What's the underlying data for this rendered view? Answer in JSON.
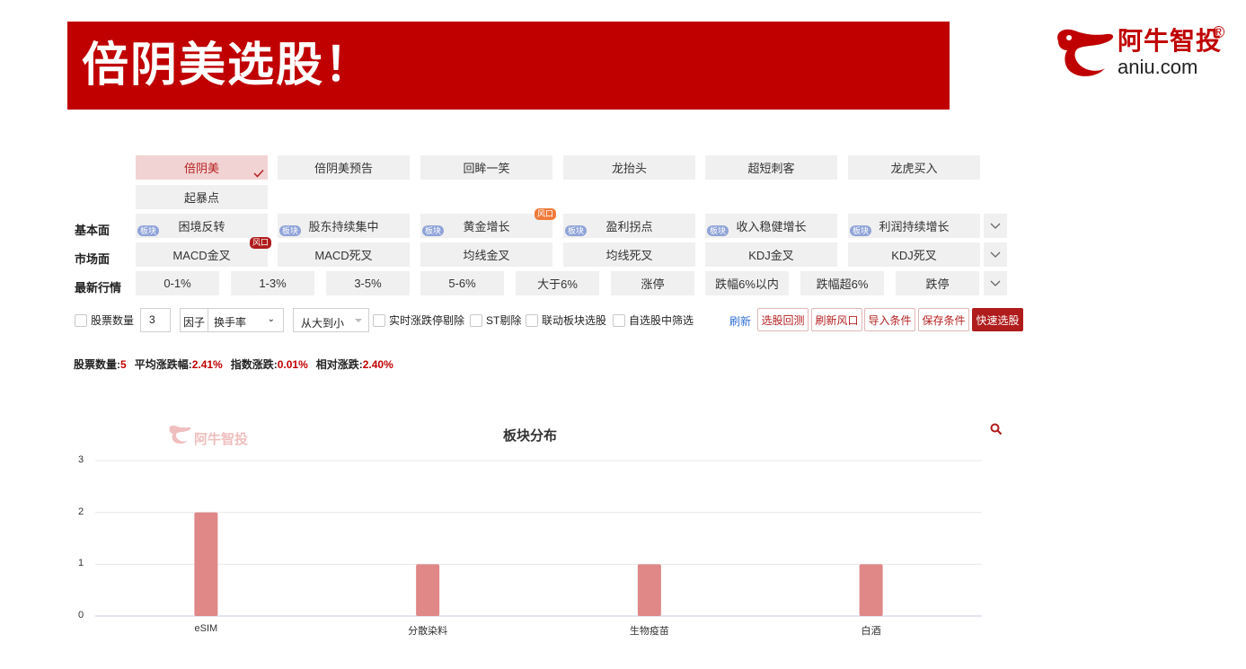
{
  "banner": {
    "title": "倍阴美选股！"
  },
  "logo": {
    "cn": "阿牛智投",
    "reg": "®",
    "en": "aniu.com"
  },
  "strategies": [
    {
      "label": "倍阴美",
      "active": true
    },
    {
      "label": "倍阴美预告"
    },
    {
      "label": "回眸一笑"
    },
    {
      "label": "龙抬头"
    },
    {
      "label": "超短刺客"
    },
    {
      "label": "龙虎买入"
    },
    {
      "label": "起暴点"
    }
  ],
  "rows": {
    "fundamental": {
      "label": "基本面",
      "items": [
        {
          "label": "困境反转",
          "badge": "板块"
        },
        {
          "label": "股东持续集中",
          "badge": "板块"
        },
        {
          "label": "黄金增长",
          "badge": "板块",
          "risk": "风口"
        },
        {
          "label": "盈利拐点",
          "badge": "板块"
        },
        {
          "label": "收入稳健增长",
          "badge": "板块"
        },
        {
          "label": "利润持续增长",
          "badge": "板块"
        }
      ]
    },
    "market": {
      "label": "市场面",
      "items": [
        {
          "label": "MACD金叉",
          "risk": "风口"
        },
        {
          "label": "MACD死叉"
        },
        {
          "label": "均线金叉"
        },
        {
          "label": "均线死叉"
        },
        {
          "label": "KDJ金叉"
        },
        {
          "label": "KDJ死叉"
        }
      ]
    },
    "quote": {
      "label": "最新行情",
      "items": [
        {
          "label": "0-1%"
        },
        {
          "label": "1-3%"
        },
        {
          "label": "3-5%"
        },
        {
          "label": "5-6%"
        },
        {
          "label": "大于6%"
        },
        {
          "label": "涨停"
        },
        {
          "label": "跌幅6%以内"
        },
        {
          "label": "跌幅超6%"
        },
        {
          "label": "跌停"
        }
      ]
    }
  },
  "controls": {
    "stock_count_label": "股票数量",
    "stock_count_value": "3",
    "factor_label": "因子",
    "factor_value": "换手率",
    "order_value": "从大到小",
    "realtime_limit_label": "实时涨跌停剔除",
    "st_label": "ST剔除",
    "linkage_label": "联动板块选股",
    "watchlist_label": "自选股中筛选",
    "refresh": "刷新",
    "backtest": "选股回测",
    "refresh_risk": "刷新风口",
    "import": "导入条件",
    "save": "保存条件",
    "quick": "快速选股"
  },
  "stats": [
    {
      "label": "股票数量:",
      "value": "5"
    },
    {
      "label": "平均涨跌幅:",
      "value": "2.41%"
    },
    {
      "label": "指数涨跌:",
      "value": "0.01%"
    },
    {
      "label": "相对涨跌:",
      "value": "2.40%"
    }
  ],
  "chart_data": {
    "type": "bar",
    "title": "板块分布",
    "categories": [
      "eSIM",
      "分散染料",
      "生物疫苗",
      "白酒"
    ],
    "values": [
      2,
      1,
      1,
      1
    ],
    "ylim": [
      0,
      3
    ],
    "yticks": [
      "0",
      "1",
      "2",
      "3"
    ],
    "grid": true,
    "bar_color": "#e08787",
    "watermark": "阿牛智投"
  },
  "colors": {
    "brand": "#c00000",
    "accent_blue": "#2f6fd6",
    "badge_blue": "#8fa3d8"
  }
}
